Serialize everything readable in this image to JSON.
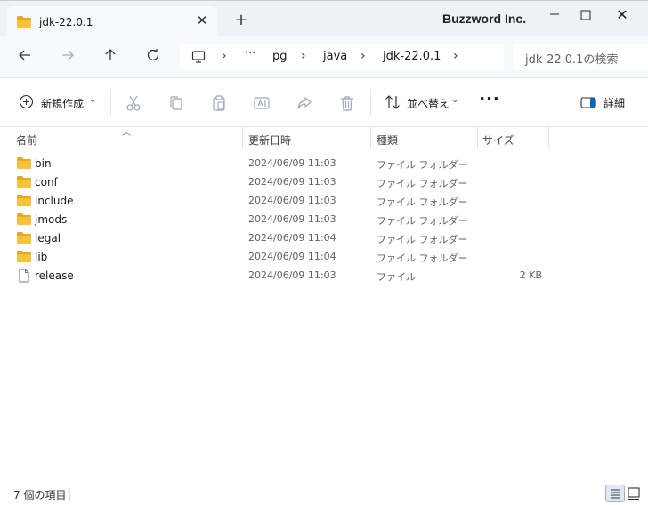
{
  "window": {
    "tab_title": "jdk-22.0.1",
    "new_tab_symbol": "+",
    "close_symbol": "✕",
    "brand": "Buzzword Inc."
  },
  "nav": {
    "breadcrumb": {
      "overflow": "···",
      "items": [
        "pg",
        "java",
        "jdk-22.0.1"
      ],
      "separator": "›"
    },
    "search_placeholder": "jdk-22.0.1の検索"
  },
  "toolbar": {
    "new_label": "新規作成",
    "sort_label": "並べ替え",
    "caret": "⌄",
    "more_label": "···",
    "details_label": "詳細"
  },
  "columns": {
    "name": "名前",
    "modified": "更新日時",
    "type": "種類",
    "size": "サイズ"
  },
  "files": [
    {
      "icon": "folder-icon",
      "name": "bin",
      "modified": "2024/06/09 11:03",
      "type": "ファイル フォルダー",
      "size": ""
    },
    {
      "icon": "folder-icon",
      "name": "conf",
      "modified": "2024/06/09 11:03",
      "type": "ファイル フォルダー",
      "size": ""
    },
    {
      "icon": "folder-icon",
      "name": "include",
      "modified": "2024/06/09 11:03",
      "type": "ファイル フォルダー",
      "size": ""
    },
    {
      "icon": "folder-icon",
      "name": "jmods",
      "modified": "2024/06/09 11:03",
      "type": "ファイル フォルダー",
      "size": ""
    },
    {
      "icon": "folder-icon",
      "name": "legal",
      "modified": "2024/06/09 11:04",
      "type": "ファイル フォルダー",
      "size": ""
    },
    {
      "icon": "folder-icon",
      "name": "lib",
      "modified": "2024/06/09 11:04",
      "type": "ファイル フォルダー",
      "size": ""
    },
    {
      "icon": "file-icon",
      "name": "release",
      "modified": "2024/06/09 11:03",
      "type": "ファイル",
      "size": "2 KB"
    }
  ],
  "status": {
    "item_count": "7 個の項目"
  },
  "colors": {
    "folder": "#f8c33a",
    "folder_dark": "#e7a823",
    "accent": "#0067c0"
  }
}
